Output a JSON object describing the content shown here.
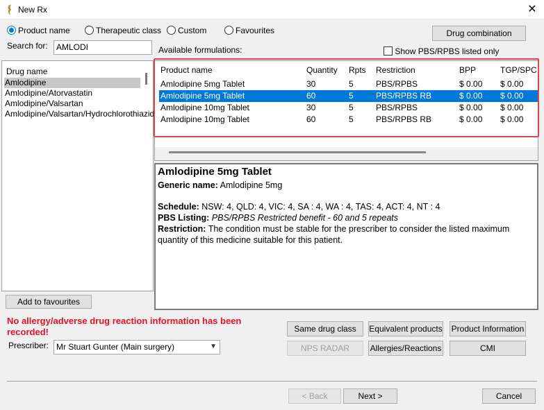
{
  "window": {
    "title": "New Rx",
    "close_glyph": "✕"
  },
  "search_mode": {
    "options": [
      "Product name",
      "Therapeutic class",
      "Custom",
      "Favourites"
    ],
    "selected": "Product name"
  },
  "search": {
    "label": "Search for:",
    "value": "AMLODI"
  },
  "drug_combination_label": "Drug combination",
  "available_label": "Available formulations:",
  "show_pbs_label": "Show PBS/RPBS listed only",
  "drug_list": {
    "header": "Drug name",
    "items": [
      "Amlodipine",
      "Amlodipine/Atorvastatin",
      "Amlodipine/Valsartan",
      "Amlodipine/Valsartan/Hydrochlorothiazide"
    ],
    "selected_index": 0
  },
  "formulations": {
    "columns": [
      "Product name",
      "Quantity",
      "Rpts",
      "Restriction",
      "BPP",
      "TGP/SPC"
    ],
    "rows": [
      [
        "Amlodipine  5mg Tablet",
        "30",
        "5",
        "PBS/RPBS",
        "$ 0.00",
        "$ 0.00"
      ],
      [
        "Amlodipine  5mg Tablet",
        "60",
        "5",
        "PBS/RPBS RB",
        "$ 0.00",
        "$ 0.00"
      ],
      [
        "Amlodipine  10mg Tablet",
        "30",
        "5",
        "PBS/RPBS",
        "$ 0.00",
        "$ 0.00"
      ],
      [
        "Amlodipine  10mg Tablet",
        "60",
        "5",
        "PBS/RPBS RB",
        "$ 0.00",
        "$ 0.00"
      ]
    ],
    "selected_index": 1
  },
  "details": {
    "title": "Amlodipine  5mg Tablet",
    "generic_label": "Generic name:",
    "generic_value": "Amlodipine  5mg",
    "schedule_label": "Schedule:",
    "schedule_value": "NSW: 4,  QLD: 4,  VIC: 4,  SA : 4,  WA : 4,  TAS: 4,  ACT: 4,  NT : 4",
    "pbs_label": "PBS Listing:",
    "pbs_value": "PBS/RPBS Restricted benefit - 60 and 5 repeats",
    "restriction_label": "Restriction:",
    "restriction_line1": "The condition must be stable for the prescriber to consider the listed maximum",
    "restriction_line2": "quantity of this medicine suitable for this patient."
  },
  "add_favourites_label": "Add to favourites",
  "warning": {
    "line1": "No allergy/adverse drug reaction information has been",
    "line2": "recorded!"
  },
  "prescriber": {
    "label": "Prescriber:",
    "value": "Mr Stuart Gunter (Main surgery)"
  },
  "actions": {
    "same_class": "Same drug class",
    "equivalent": "Equivalent products",
    "product_info": "Product Information",
    "nps_radar": "NPS RADAR",
    "allergies": "Allergies/Reactions",
    "cmi": "CMI"
  },
  "nav": {
    "back": "< Back",
    "next": "Next >",
    "cancel": "Cancel"
  },
  "colors": {
    "selection": "#0078d7",
    "warning": "#e81123",
    "highlight_frame": "#e0454a"
  }
}
